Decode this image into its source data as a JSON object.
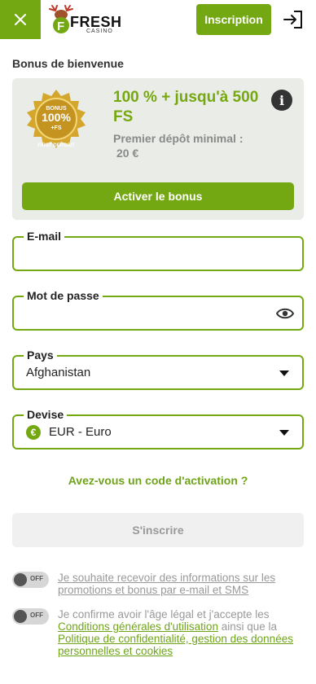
{
  "header": {
    "brand_text": "FRESH",
    "brand_sub": "CASINO",
    "signup_label": "Inscription"
  },
  "bonus": {
    "section_title": "Bonus de bienvenue",
    "medal_text": [
      "BONUS",
      "100%",
      "+FS",
      "FIRST DEPOSIT"
    ],
    "amount": "100 % + jusqu'à 500 FS",
    "min_label": "Premier dépôt minimal :",
    "min_value": "20 €",
    "activate_label": "Activer le bonus"
  },
  "form": {
    "email": {
      "label": "E-mail",
      "value": ""
    },
    "password": {
      "label": "Mot de passe",
      "value": ""
    },
    "country": {
      "label": "Pays",
      "value": "Afghanistan"
    },
    "currency": {
      "label": "Devise",
      "value": "EUR - Euro",
      "badge": "€"
    }
  },
  "activation_link": "Avez-vous un code d'activation ?",
  "submit_label": "S'inscrire",
  "consents": [
    {
      "toggle": "OFF",
      "text": "Je souhaite recevoir des informations sur les promotions et bonus par e-mail et SMS"
    },
    {
      "toggle": "OFF",
      "part1": "Je confirme avoir l'âge légal et j'accepte les ",
      "link1": "Conditions générales d'utilisation",
      "part2": " ainsi que la ",
      "link2": "Politique de confidentialité, gestion des données personnelles et cookies"
    }
  ],
  "colors": {
    "accent": "#74a813",
    "card_bg": "#e9ece7",
    "muted": "#999999"
  }
}
